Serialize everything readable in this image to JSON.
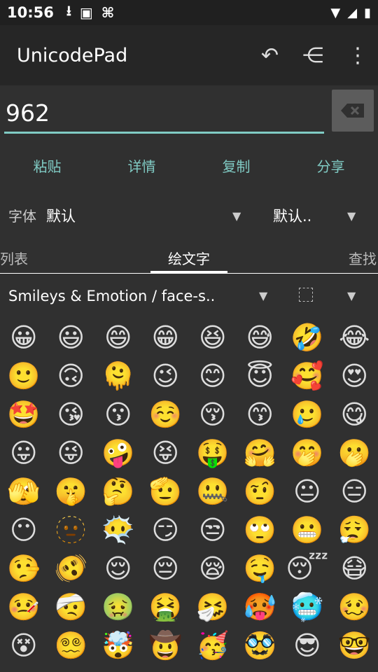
{
  "status": {
    "time": "10:56"
  },
  "app": {
    "title": "UnicodePad"
  },
  "input": {
    "value": "962"
  },
  "actions": [
    "粘贴",
    "详情",
    "复制",
    "分享"
  ],
  "font": {
    "label": "字体",
    "value": "默认",
    "value2": "默认.."
  },
  "tabs": [
    "列表",
    "绘文字",
    "查找"
  ],
  "category": "Smileys & Emotion / face-s..",
  "emoji_rows": [
    [
      "😀",
      "😃",
      "😄",
      "😁",
      "😆",
      "😅",
      "🤣",
      "😂"
    ],
    [
      "🙂",
      "🙃",
      "🫠",
      "😉",
      "😊",
      "😇",
      "🥰",
      "😍"
    ],
    [
      "🤩",
      "😘",
      "😗",
      "☺️",
      "😚",
      "😙",
      "🥲",
      "😋"
    ],
    [
      "😛",
      "😜",
      "🤪",
      "😝",
      "🤑",
      "🤗",
      "🤭",
      "🫢"
    ],
    [
      "🫣",
      "🤫",
      "🤔",
      "🫡",
      "🤐",
      "🤨",
      "😐",
      "😑"
    ],
    [
      "😶",
      "🫥",
      "😶‍🌫️",
      "😏",
      "😒",
      "🙄",
      "😬",
      "😮‍💨"
    ],
    [
      "🤥",
      "🫨",
      "😌",
      "😔",
      "😪",
      "🤤",
      "😴",
      "😷"
    ],
    [
      "🤒",
      "🤕",
      "🤢",
      "🤮",
      "🤧",
      "🥵",
      "🥶",
      "🥴"
    ],
    [
      "😵",
      "😵‍💫",
      "🤯",
      "🤠",
      "🥳",
      "🥸",
      "😎",
      "🤓"
    ]
  ]
}
